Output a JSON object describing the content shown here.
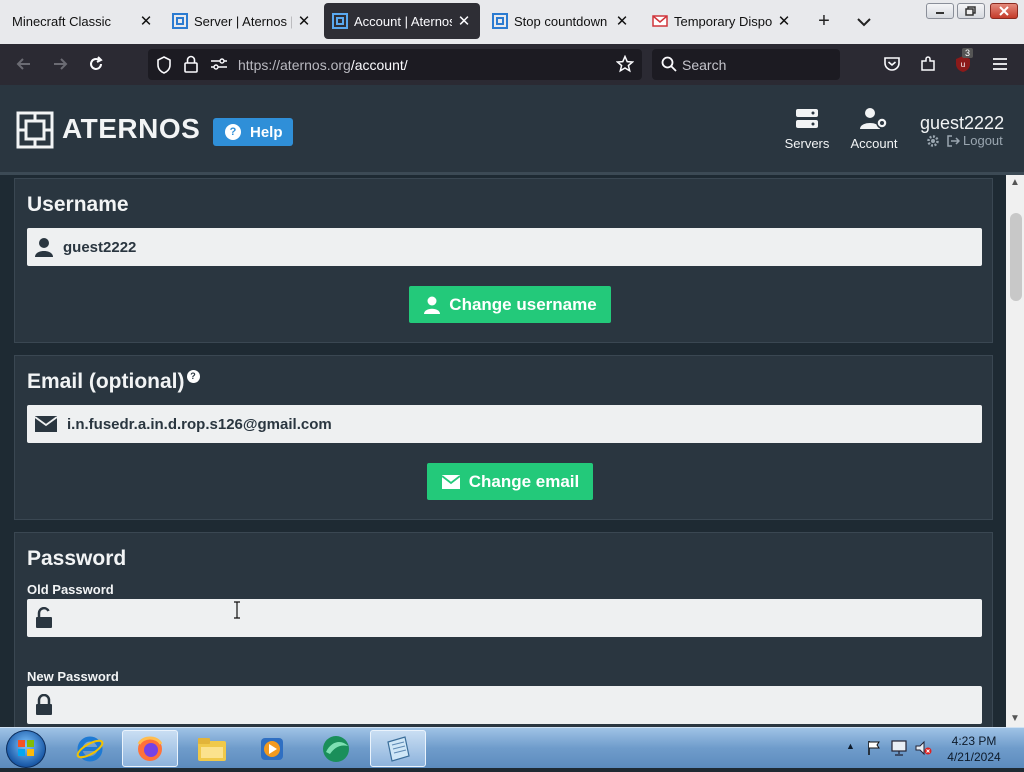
{
  "browser": {
    "tabs": [
      {
        "label": "Minecraft Classic",
        "icon": "no-favicon",
        "active": false
      },
      {
        "label": "Server | Aternos | Fr",
        "icon": "aternos-favicon",
        "active": false
      },
      {
        "label": "Account | Aternos |",
        "icon": "aternos-favicon",
        "active": true
      },
      {
        "label": "Stop countdown – A",
        "icon": "aternos-favicon",
        "active": false
      },
      {
        "label": "Temporary Disposa",
        "icon": "mail-favicon",
        "active": false
      }
    ],
    "url_host": "https://aternos.org",
    "url_path": "/account/",
    "search_placeholder": "Search",
    "extension_badge": "3"
  },
  "site": {
    "brand": "ATERNOS",
    "help_label": "Help",
    "nav": [
      {
        "label": "Servers",
        "icon": "servers-icon"
      },
      {
        "label": "Account",
        "icon": "account-gear-icon"
      }
    ],
    "username": "guest2222",
    "logout_label": "Logout"
  },
  "account": {
    "username_section": {
      "title": "Username",
      "value": "guest2222",
      "button": "Change username"
    },
    "email_section": {
      "title": "Email (optional)",
      "hint": "?",
      "value": "i.n.fusedr.a.in.d.rop.s126@gmail.com",
      "button": "Change email"
    },
    "password_section": {
      "title": "Password",
      "old_label": "Old Password",
      "old_value": "",
      "new_label": "New Password",
      "new_value": ""
    }
  },
  "taskbar": {
    "items": [
      "internet-explorer",
      "firefox",
      "file-explorer",
      "media-player",
      "app-green",
      "notepad"
    ],
    "time": "4:23 PM",
    "date": "4/21/2024"
  },
  "colors": {
    "page_bg": "#1e2a33",
    "card_bg": "#2a3640",
    "accent_green": "#23c97a",
    "help_blue": "#2f8fd8"
  }
}
